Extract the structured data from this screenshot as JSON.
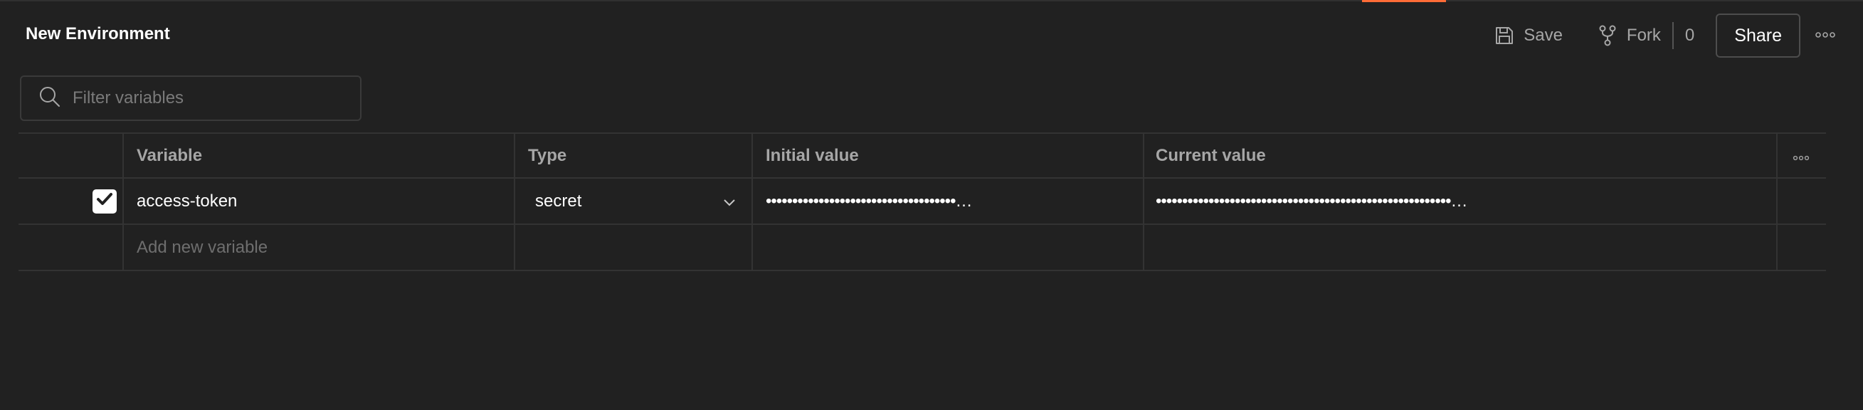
{
  "header": {
    "title": "New Environment",
    "save_label": "Save",
    "fork_label": "Fork",
    "fork_count": "0",
    "share_label": "Share"
  },
  "search": {
    "placeholder": "Filter variables",
    "value": ""
  },
  "table": {
    "columns": [
      "Variable",
      "Type",
      "Initial value",
      "Current value"
    ],
    "rows": [
      {
        "enabled": true,
        "variable": "access-token",
        "type": "secret",
        "initial_value": "••••••••••••••••••••••••••••••••••••…",
        "current_value": "••••••••••••••••••••••••••••••••••••••••••••••••••••••••…"
      }
    ],
    "add_placeholder": "Add new variable"
  },
  "colors": {
    "accent": "#ff6c37",
    "background": "#212121",
    "border": "#333333",
    "muted_text": "#a6a6a6"
  }
}
